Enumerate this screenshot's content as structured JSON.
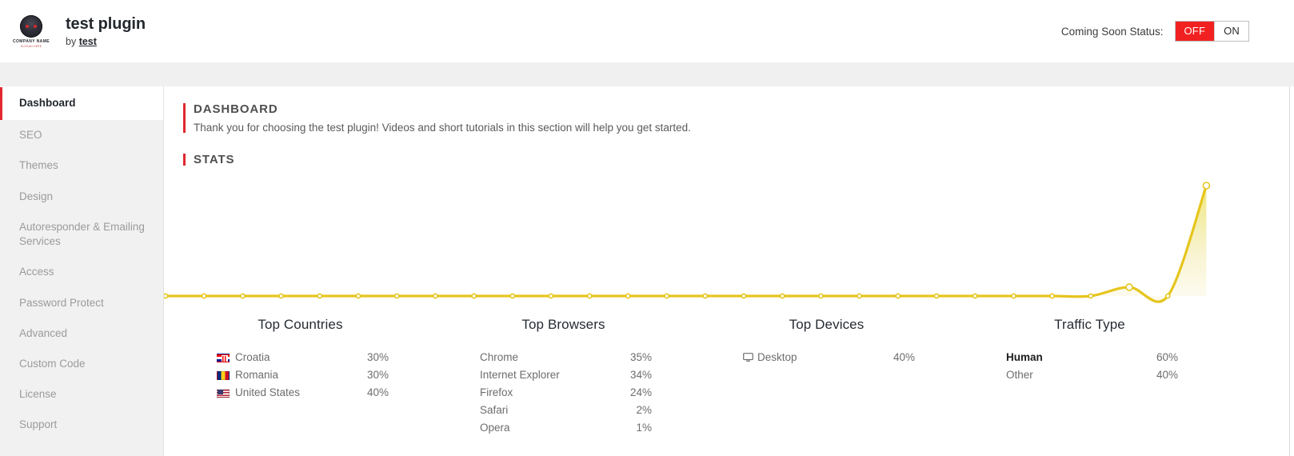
{
  "header": {
    "logo": {
      "icon": "company-logo-badge",
      "name": "COMPANY NAME",
      "tagline": "SLOGAN HERE"
    },
    "plugin_title": "test plugin",
    "by_prefix": "by ",
    "author": "test",
    "coming_soon_label": "Coming Soon Status:",
    "toggle": {
      "off_label": "OFF",
      "on_label": "ON",
      "active": "OFF",
      "active_color": "#f22121"
    }
  },
  "sidebar": {
    "items": [
      {
        "label": "Dashboard",
        "active": true
      },
      {
        "label": "SEO",
        "active": false
      },
      {
        "label": "Themes",
        "active": false
      },
      {
        "label": "Design",
        "active": false
      },
      {
        "label": "Autoresponder & Emailing Services",
        "active": false
      },
      {
        "label": "Access",
        "active": false
      },
      {
        "label": "Password Protect",
        "active": false
      },
      {
        "label": "Advanced",
        "active": false
      },
      {
        "label": "Custom Code",
        "active": false
      },
      {
        "label": "License",
        "active": false
      },
      {
        "label": "Support",
        "active": false
      }
    ],
    "accent_color": "#e0282e"
  },
  "main": {
    "dashboard": {
      "title": "DASHBOARD",
      "description": "Thank you for choosing the test plugin! Videos and short tutorials in this section will help you get started."
    },
    "stats": {
      "title": "STATS"
    }
  },
  "chart_data": {
    "type": "area",
    "title": "STATS",
    "xlabel": "",
    "ylabel": "",
    "grid": false,
    "legend": false,
    "line_color": "#e6c51d",
    "fill_color": "#f7eec2",
    "marker_color": "#ffffff",
    "ylim": [
      0,
      100
    ],
    "x": [
      1,
      2,
      3,
      4,
      5,
      6,
      7,
      8,
      9,
      10,
      11,
      12,
      13,
      14,
      15,
      16,
      17,
      18,
      19,
      20,
      21,
      22,
      23,
      24,
      25,
      26,
      27,
      28,
      29
    ],
    "values": [
      0,
      0,
      0,
      0,
      0,
      0,
      0,
      0,
      0,
      0,
      0,
      0,
      0,
      0,
      0,
      0,
      0,
      0,
      0,
      0,
      0,
      0,
      0,
      0,
      0,
      8,
      0,
      100
    ]
  },
  "panels": [
    {
      "title": "Top Countries",
      "rows": [
        {
          "icon": "flag-croatia",
          "label": "Croatia",
          "value": "30%",
          "emphasis": false
        },
        {
          "icon": "flag-romania",
          "label": "Romania",
          "value": "30%",
          "emphasis": false
        },
        {
          "icon": "flag-united-states",
          "label": "United States",
          "value": "40%",
          "emphasis": false
        }
      ]
    },
    {
      "title": "Top Browsers",
      "rows": [
        {
          "icon": null,
          "label": "Chrome",
          "value": "35%",
          "emphasis": false
        },
        {
          "icon": null,
          "label": "Internet Explorer",
          "value": "34%",
          "emphasis": false
        },
        {
          "icon": null,
          "label": "Firefox",
          "value": "24%",
          "emphasis": false
        },
        {
          "icon": null,
          "label": "Safari",
          "value": "2%",
          "emphasis": false
        },
        {
          "icon": null,
          "label": "Opera",
          "value": "1%",
          "emphasis": false
        }
      ]
    },
    {
      "title": "Top Devices",
      "rows": [
        {
          "icon": "monitor-icon",
          "label": "Desktop",
          "value": "40%",
          "emphasis": false
        }
      ]
    },
    {
      "title": "Traffic Type",
      "rows": [
        {
          "icon": null,
          "label": "Human",
          "value": "60%",
          "emphasis": true
        },
        {
          "icon": null,
          "label": "Other",
          "value": "40%",
          "emphasis": false
        }
      ]
    }
  ]
}
